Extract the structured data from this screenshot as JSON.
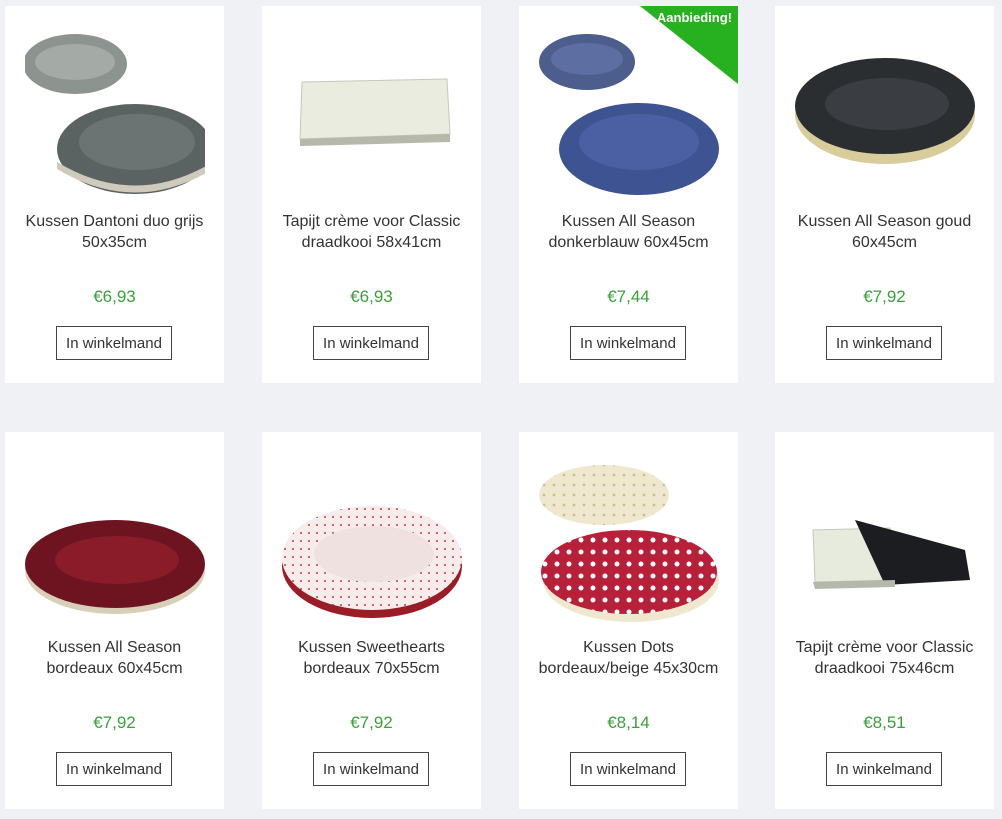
{
  "colors": {
    "price": "#3aa03a",
    "ribbon": "#27b01f",
    "background": "#f0f1f5"
  },
  "products": [
    {
      "title": "Kussen Dantoni duo grijs 50x35cm",
      "price": "€6,93",
      "button": "In winkelmand",
      "image": "grey-duo-cushion"
    },
    {
      "title": "Tapijt crème voor Classic draadkooi 58x41cm",
      "price": "€6,93",
      "button": "In winkelmand",
      "image": "cream-mat"
    },
    {
      "title": "Kussen All Season donkerblauw 60x45cm",
      "price": "€7,44",
      "button": "In winkelmand",
      "image": "navy-cushion",
      "badge": "Aanbieding!"
    },
    {
      "title": "Kussen All Season goud 60x45cm",
      "price": "€7,92",
      "button": "In winkelmand",
      "image": "black-gold-cushion"
    },
    {
      "title": "Kussen All Season bordeaux 60x45cm",
      "price": "€7,92",
      "button": "In winkelmand",
      "image": "bordeaux-cushion"
    },
    {
      "title": "Kussen Sweethearts bordeaux 70x55cm",
      "price": "€7,92",
      "button": "In winkelmand",
      "image": "sweethearts-cushion"
    },
    {
      "title": "Kussen Dots bordeaux/beige 45x30cm",
      "price": "€8,14",
      "button": "In winkelmand",
      "image": "dots-cushion"
    },
    {
      "title": "Tapijt crème voor Classic draadkooi 75x46cm",
      "price": "€8,51",
      "button": "In winkelmand",
      "image": "cream-black-mat"
    }
  ]
}
